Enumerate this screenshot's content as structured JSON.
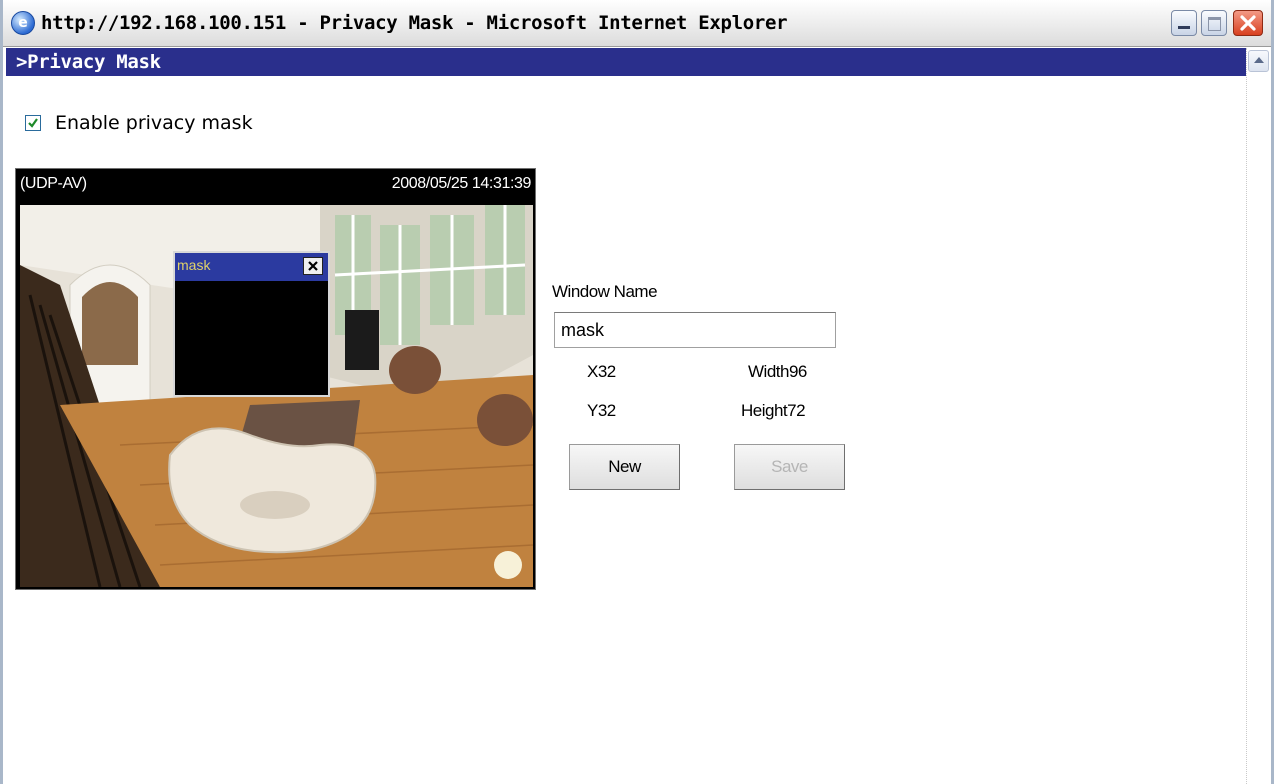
{
  "window": {
    "title": "http://192.168.100.151 - Privacy Mask - Microsoft Internet Explorer",
    "icon": "ie-icon"
  },
  "section": {
    "title": ">Privacy Mask"
  },
  "enable_mask": {
    "label": "Enable privacy mask",
    "checked": true
  },
  "video": {
    "stream": "(UDP-AV)",
    "timestamp": "2008/05/25 14:31:39",
    "mask_window": {
      "name": "mask"
    }
  },
  "editor": {
    "window_name_label": "Window Name",
    "window_name_value": "mask",
    "x_label": "X32",
    "y_label": "Y32",
    "width_label": "Width96",
    "height_label": "Height72",
    "new_button": "New",
    "save_button": "Save"
  },
  "colors": {
    "section_bar": "#2a2f8c",
    "mask_titlebar": "#2b3aa0",
    "close_button": "#d8401f"
  }
}
